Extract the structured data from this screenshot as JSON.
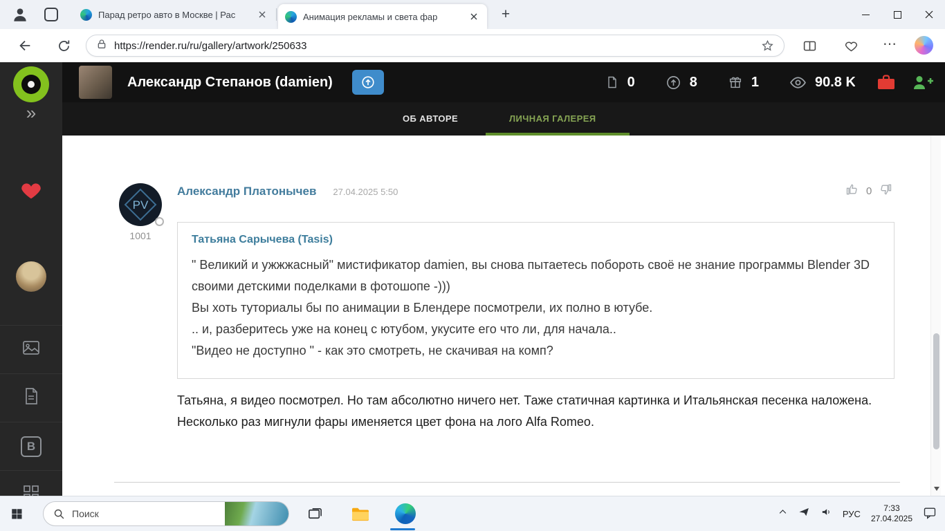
{
  "browser": {
    "tabs": [
      {
        "title": "Парад ретро авто в Москве | Рас"
      },
      {
        "title": "Анимация рекламы и света фар"
      }
    ],
    "url": "https://render.ru/ru/gallery/artwork/250633"
  },
  "icons": {
    "chevron_double_right": "»",
    "more_horizontal": "⋯",
    "new_tab": "+",
    "sidebar_letter": "B"
  },
  "page": {
    "header": {
      "author_title": "Александр Степанов (damien)",
      "stats": [
        {
          "name": "posts",
          "value": "0"
        },
        {
          "name": "rating",
          "value": "8"
        },
        {
          "name": "awards",
          "value": "1"
        },
        {
          "name": "views",
          "value": "90.8 K"
        }
      ]
    },
    "nav": {
      "tab_about": "ОБ АВТОРЕ",
      "tab_gallery": "ЛИЧНАЯ ГАЛЕРЕЯ"
    },
    "comment": {
      "author": "Александр Платонычев",
      "author_rating": "1001",
      "avatar_monogram": "PV",
      "date": "27.04.2025 5:50",
      "likes": "0",
      "quote": {
        "author": "Татьяна Сарычева (Tasis)",
        "p1": "\" Великий и ужжжасный\" мистификатор damien, вы снова пытаетесь побороть своё не знание программы Blender 3D своими детскими поделками в фотошопе -)))",
        "p2": "Вы хоть туториалы бы по анимации в Блендере посмотрели, их полно в ютубе.",
        "p3": ".. и, разберитесь уже на конец с ютубом, укусите его что ли, для начала..",
        "p4": "\"Видео не доступно \" - как это смотреть, не скачивая на комп?"
      },
      "reply": "Татьяна, я видео посмотрел. Но там абсолютно ничего нет. Таже статичная картинка и Итальянская песенка наложена. Несколько раз мигнули фары именяется цвет фона на лого Alfa Romeo."
    }
  },
  "taskbar": {
    "search_placeholder": "Поиск",
    "language": "РУС",
    "time": "7:33",
    "date": "27.04.2025"
  }
}
